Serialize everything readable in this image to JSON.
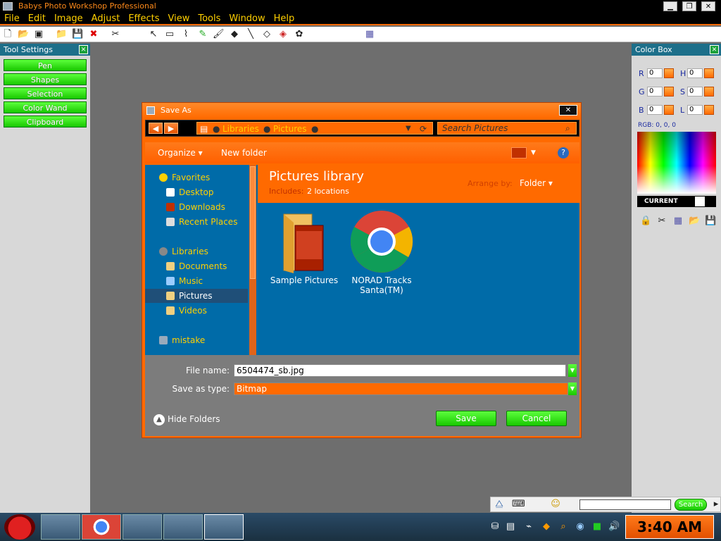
{
  "window": {
    "title": "Babys Photo Workshop Professional"
  },
  "menu": [
    "File",
    "Edit",
    "Image",
    "Adjust",
    "Effects",
    "View",
    "Tools",
    "Window",
    "Help"
  ],
  "tool_settings": {
    "title": "Tool Settings",
    "buttons": [
      "Pen",
      "Shapes",
      "Selection",
      "Color Wand",
      "Clipboard"
    ]
  },
  "color_box": {
    "title": "Color Box",
    "channels": [
      {
        "label": "R",
        "value": "0"
      },
      {
        "label": "G",
        "value": "0"
      },
      {
        "label": "B",
        "value": "0"
      },
      {
        "label": "H",
        "value": "0"
      },
      {
        "label": "S",
        "value": "0"
      },
      {
        "label": "L",
        "value": "0"
      }
    ],
    "rgb_readout": "RGB: 0, 0, 0",
    "current_label": "CURRENT"
  },
  "dialog": {
    "title": "Save As",
    "breadcrumb": [
      "Libraries",
      "Pictures"
    ],
    "search_placeholder": "Search Pictures",
    "organize": "Organize",
    "new_folder": "New folder",
    "nav": [
      {
        "label": "Favorites",
        "kind": "header"
      },
      {
        "label": "Desktop"
      },
      {
        "label": "Downloads"
      },
      {
        "label": "Recent Places"
      },
      {
        "label": "Libraries",
        "kind": "header"
      },
      {
        "label": "Documents"
      },
      {
        "label": "Music"
      },
      {
        "label": "Pictures",
        "selected": true
      },
      {
        "label": "Videos"
      },
      {
        "label": "mistake",
        "kind": "header"
      }
    ],
    "library_title": "Pictures library",
    "library_includes": "Includes:",
    "library_locations": "2 locations",
    "arrange_by": "Arrange by:",
    "arrange_value": "Folder",
    "items": [
      {
        "name": "Sample Pictures",
        "icon": "folder-icon"
      },
      {
        "name": "NORAD Tracks Santa(TM)",
        "icon": "chrome-icon"
      }
    ],
    "file_name_label": "File name:",
    "file_name_value": "6504474_sb.jpg",
    "save_type_label": "Save as type:",
    "save_type_value": "Bitmap",
    "hide_folders": "Hide Folders",
    "save": "Save",
    "cancel": "Cancel"
  },
  "deskbar": {
    "search_button": "Search"
  },
  "taskbar": {
    "clock": "3:40 AM"
  },
  "colors": {
    "accent": "#ff6a00",
    "nav_blue": "#006ba8",
    "green": "#19c800"
  }
}
